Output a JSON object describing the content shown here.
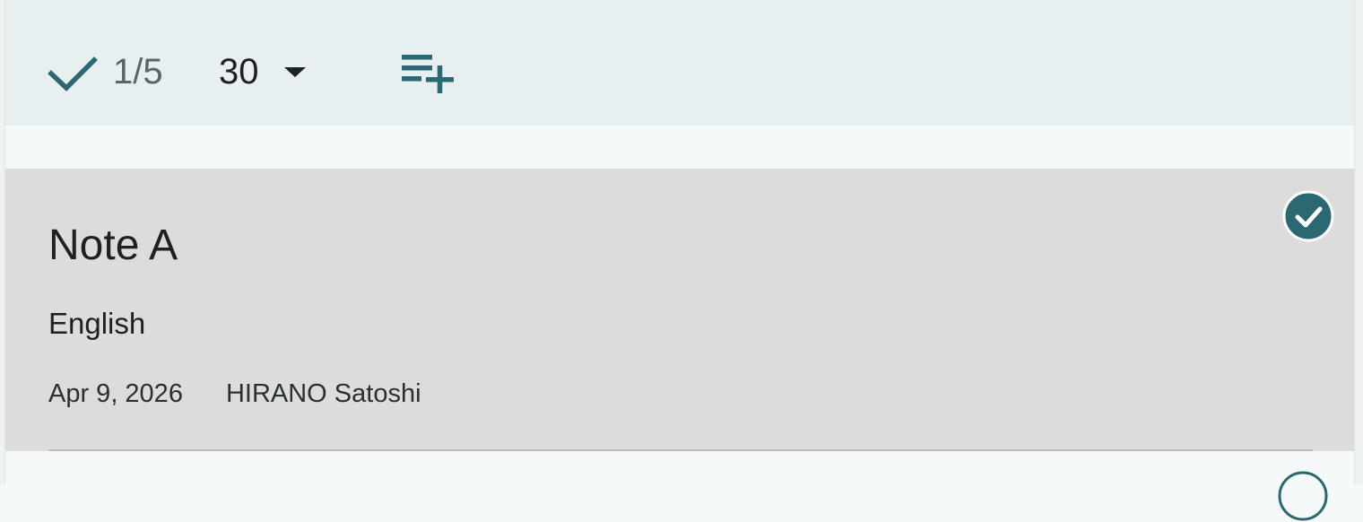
{
  "toolbar": {
    "selection_count": "1/5",
    "page_size": "30",
    "icons": {
      "select_all": "check-icon",
      "page_size_caret": "caret-down-icon",
      "add_to_list": "playlist-add-icon"
    }
  },
  "notes": [
    {
      "title": "Note A",
      "language": "English",
      "date": "Apr 9, 2026",
      "author": "HIRANO Satoshi",
      "selected": true
    }
  ],
  "colors": {
    "accent": "#2a6872",
    "toolbar_bg": "#e8eff0",
    "selected_card_bg": "#dcdcdc",
    "list_bg": "#f5f9fa"
  }
}
